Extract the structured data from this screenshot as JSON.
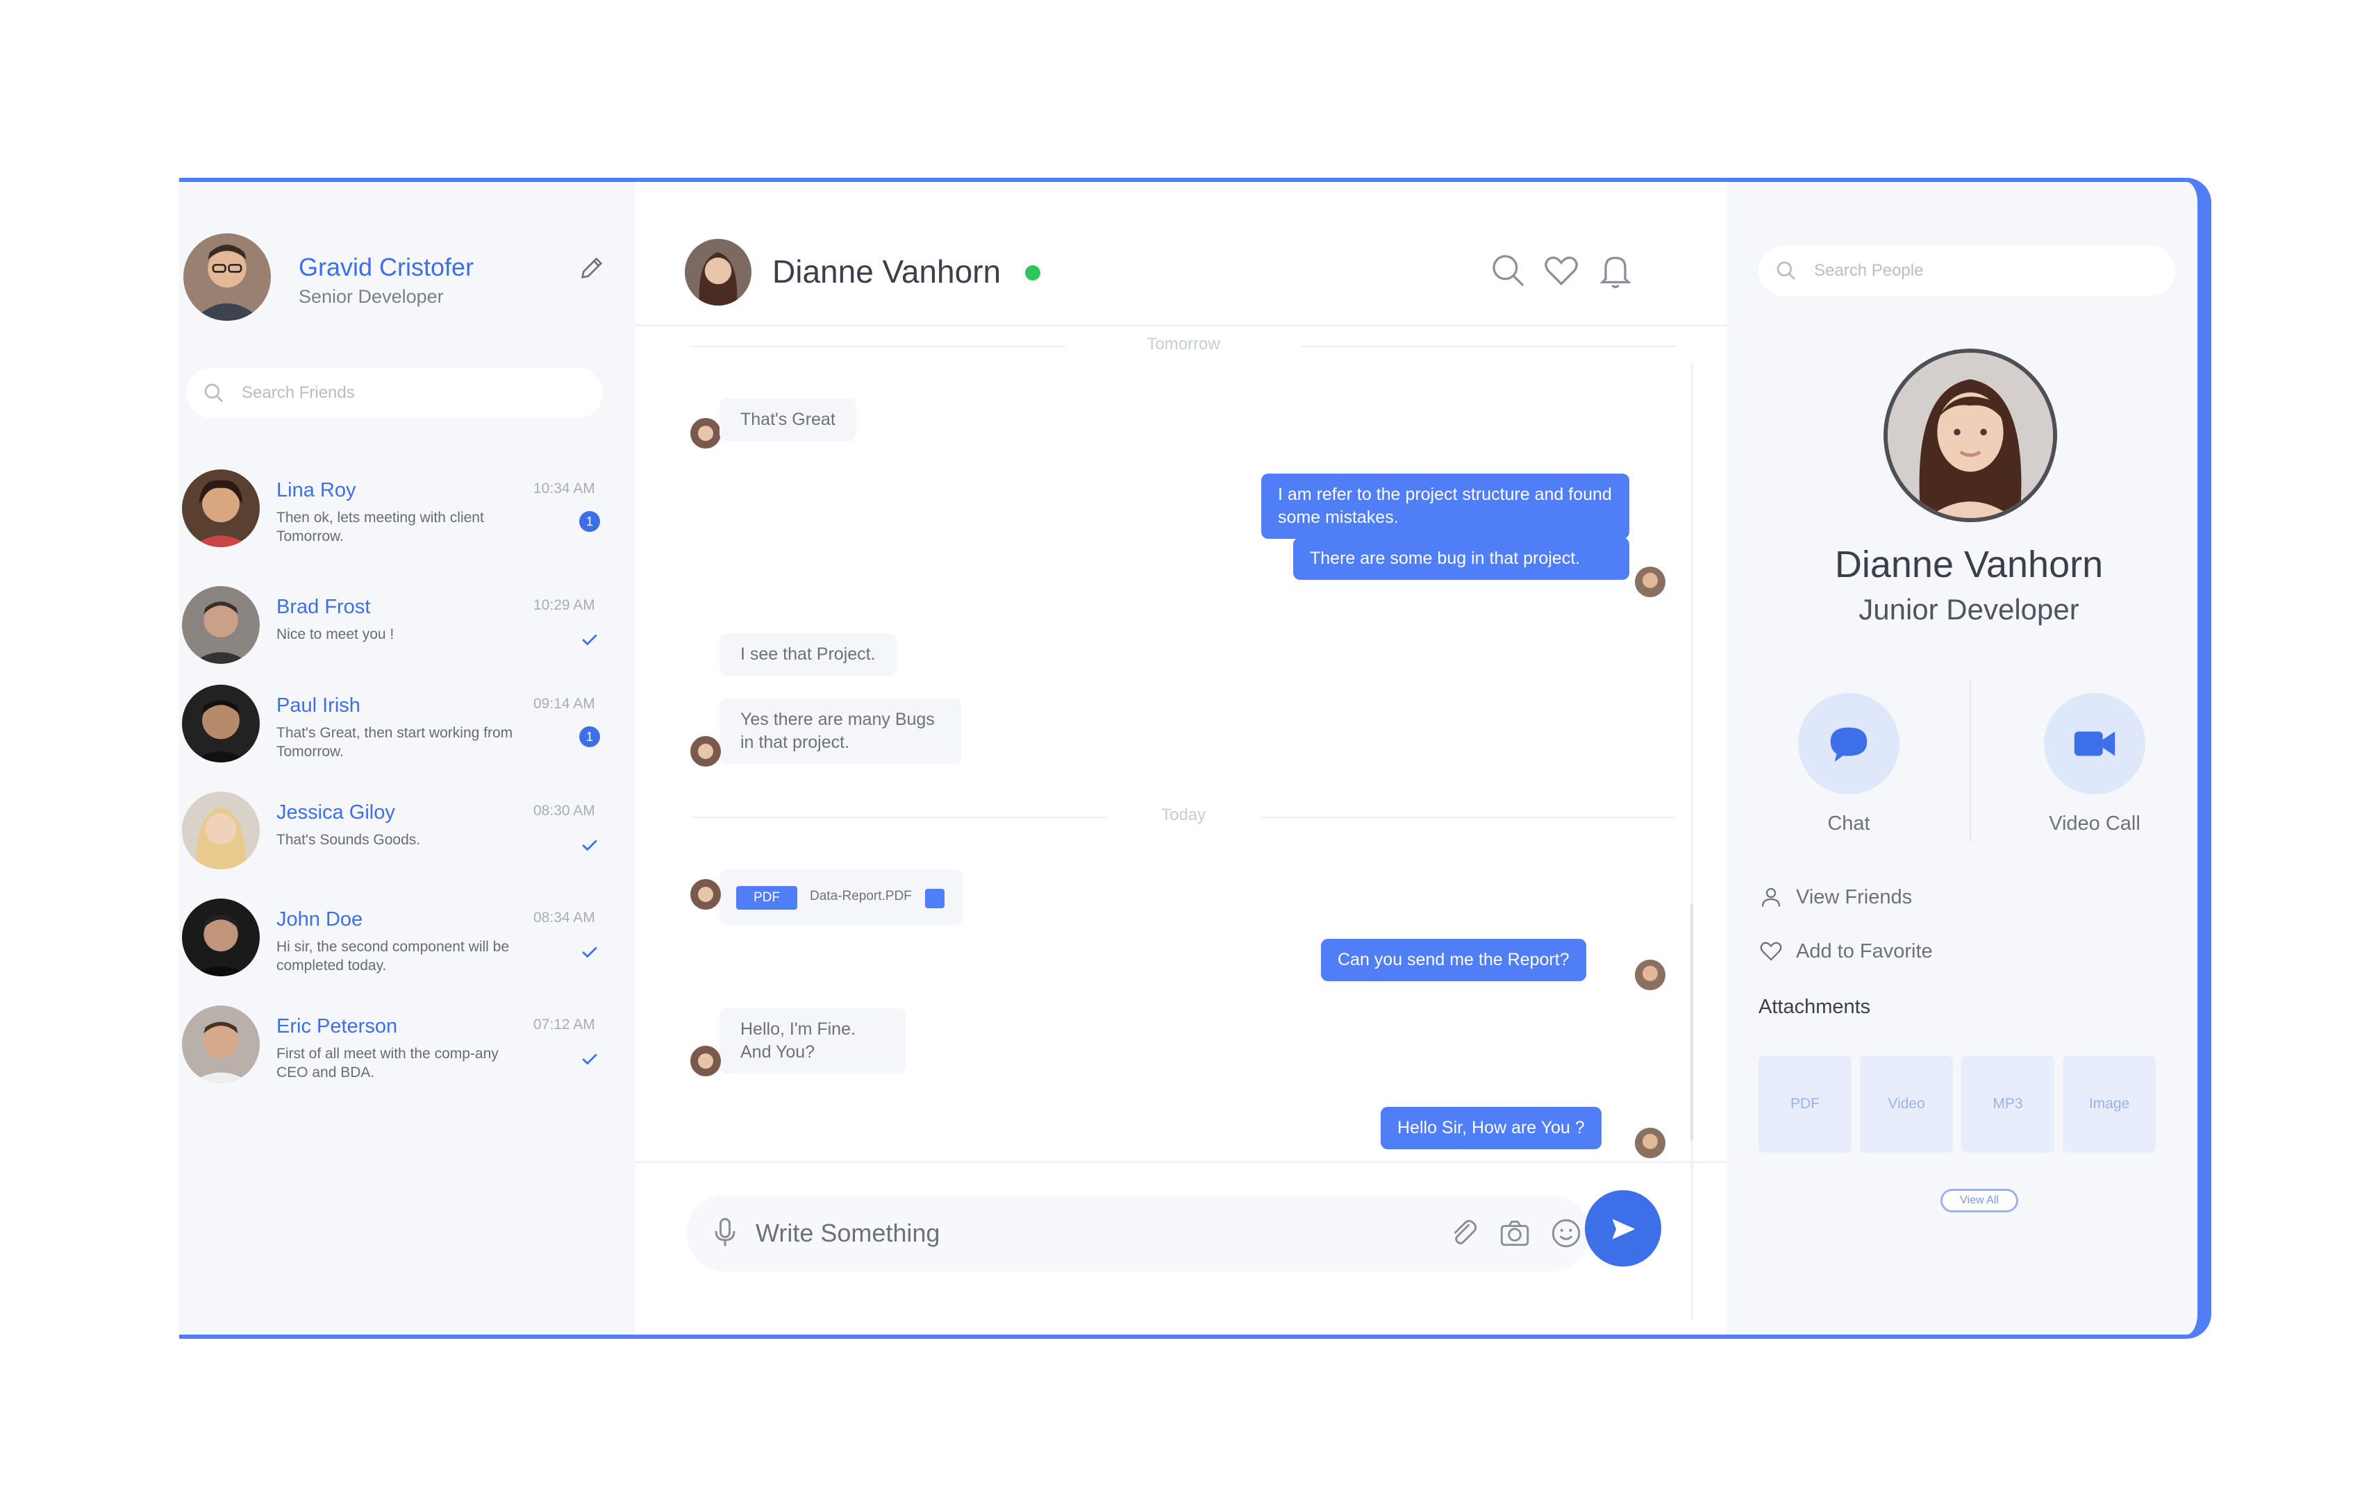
{
  "current_user": {
    "name": "Gravid Cristofer",
    "role": "Senior Developer"
  },
  "sidebar": {
    "search_placeholder": "Search Friends",
    "contacts": [
      {
        "name": "Lina Roy",
        "message": "Then ok, lets meeting with client Tomorrow.",
        "time": "10:34 AM",
        "status": "unread",
        "badge": "1",
        "avatar_color": "#c99a72"
      },
      {
        "name": "Brad Frost",
        "message": "Nice to meet you !",
        "time": "10:29 AM",
        "status": "read",
        "badge": "",
        "avatar_color": "#8a7a6e"
      },
      {
        "name": "Paul Irish",
        "message": "That's Great, then start working from Tomorrow.",
        "time": "09:14 AM",
        "status": "unread",
        "badge": "1",
        "avatar_color": "#6a5a50"
      },
      {
        "name": "Jessica Giloy",
        "message": "That's Sounds Goods.",
        "time": "08:30 AM",
        "status": "read",
        "badge": "",
        "avatar_color": "#e6c79a"
      },
      {
        "name": "John Doe",
        "message": "Hi sir, the second component will be completed today.",
        "time": "08:34 AM",
        "status": "read",
        "badge": "",
        "avatar_color": "#5a4a44"
      },
      {
        "name": "Eric Peterson",
        "message": "First of all meet with the comp-any CEO and BDA.",
        "time": "07:12 AM",
        "status": "read",
        "badge": "",
        "avatar_color": "#b08a78"
      }
    ]
  },
  "chat": {
    "peer_name": "Dianne Vanhorn",
    "peer_status": "online",
    "separators": {
      "yesterday": "Tomorrow",
      "today": "Today"
    },
    "messages": {
      "m1": "That's Great",
      "m2": "I am refer to the project structure and found some mistakes.",
      "m3": "There are some bug in that project.",
      "m4": "I see that Project.",
      "m5": "Yes there are many Bugs in that project.",
      "m6_tag": "PDF",
      "m6_file": "Data-Report.PDF",
      "m7": "Can you send me the Report?",
      "m8": "Hello, I'm Fine. And You?",
      "m9": "Hello Sir, How are You ?"
    },
    "composer_placeholder": "Write Something"
  },
  "profile": {
    "search_placeholder": "Search People",
    "name": "Dianne Vanhorn",
    "role": "Junior Developer",
    "actions": {
      "chat": "Chat",
      "video": "Video Call"
    },
    "menu": {
      "view_friends": "View Friends",
      "add_favorite": "Add to Favorite"
    },
    "attachments_title": "Attachments",
    "attachments": [
      "PDF",
      "Video",
      "MP3",
      "Image"
    ],
    "view_all": "View All"
  },
  "colors": {
    "accent": "#4f7ef7",
    "online": "#2ec55c",
    "panel_bg": "#f6f7fb"
  }
}
